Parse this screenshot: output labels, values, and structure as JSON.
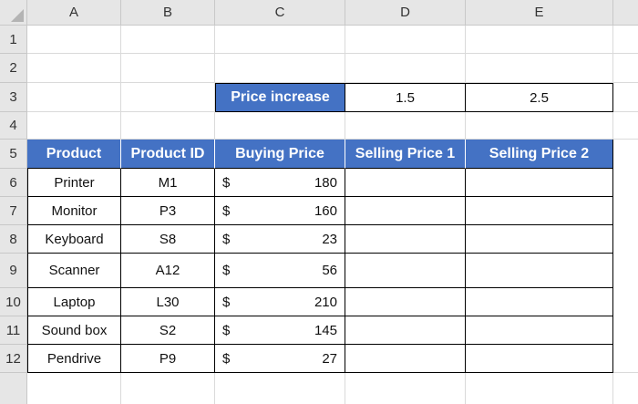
{
  "column_headers": [
    "A",
    "B",
    "C",
    "D",
    "E"
  ],
  "row_headers": [
    "1",
    "2",
    "3",
    "4",
    "5",
    "6",
    "7",
    "8",
    "9",
    "10",
    "11",
    "12"
  ],
  "price_increase": {
    "label": "Price increase",
    "value_1": "1.5",
    "value_2": "2.5"
  },
  "table_headers": [
    "Product",
    "Product ID",
    "Buying Price",
    "Selling Price 1",
    "Selling Price 2"
  ],
  "currency_symbol": "$",
  "rows": [
    {
      "product": "Printer",
      "id": "M1",
      "price": "180",
      "sell1": "",
      "sell2": ""
    },
    {
      "product": "Monitor",
      "id": "P3",
      "price": "160",
      "sell1": "",
      "sell2": ""
    },
    {
      "product": "Keyboard",
      "id": "S8",
      "price": "23",
      "sell1": "",
      "sell2": ""
    },
    {
      "product": "Scanner",
      "id": "A12",
      "price": "56",
      "sell1": "",
      "sell2": ""
    },
    {
      "product": "Laptop",
      "id": "L30",
      "price": "210",
      "sell1": "",
      "sell2": ""
    },
    {
      "product": "Sound box",
      "id": "S2",
      "price": "145",
      "sell1": "",
      "sell2": ""
    },
    {
      "product": "Pendrive",
      "id": "P9",
      "price": "27",
      "sell1": "",
      "sell2": ""
    }
  ],
  "colors": {
    "header_fill": "#4472c4",
    "header_text": "#ffffff"
  }
}
